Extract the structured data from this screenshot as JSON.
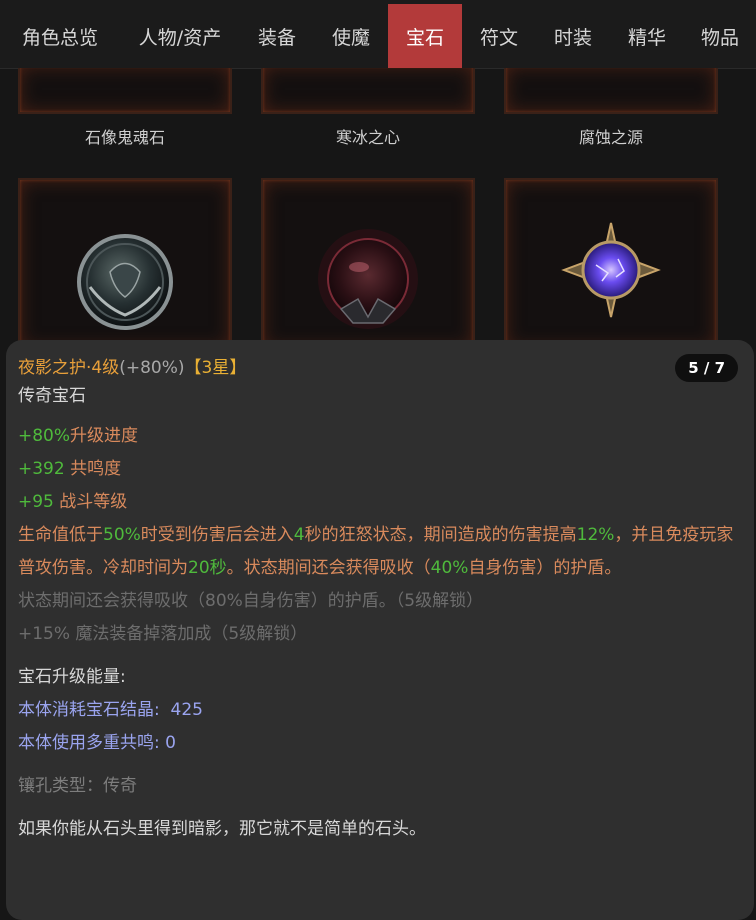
{
  "tabs": [
    {
      "label": "角色总览",
      "active": false
    },
    {
      "label": "人物/资产",
      "active": false
    },
    {
      "label": "装备",
      "active": false
    },
    {
      "label": "使魔",
      "active": false
    },
    {
      "label": "宝石",
      "active": true
    },
    {
      "label": "符文",
      "active": false
    },
    {
      "label": "时装",
      "active": false
    },
    {
      "label": "精华",
      "active": false
    },
    {
      "label": "物品",
      "active": false
    }
  ],
  "gems_row1": [
    "石像鬼魂石",
    "寒冰之心",
    "腐蚀之源"
  ],
  "tooltip": {
    "name": "夜影之护·4级",
    "bonus": "(+80%)",
    "stars": "【3星】",
    "counter": "5 / 7",
    "type": "传奇宝石",
    "stats": [
      {
        "value": "+80%",
        "label": "升级进度"
      },
      {
        "value": "+392",
        "label": " 共鸣度"
      },
      {
        "value": "+95",
        "label": " 战斗等级"
      }
    ],
    "desc": {
      "p1": "生命值低于",
      "v1": "50%",
      "p2": "时受到伤害后会进入",
      "v2": "4",
      "p3": "秒的狂怒状态，期间造成的伤害提高",
      "v3": "12%",
      "p4": "，并且免疫玩家普攻伤害。冷却时间为",
      "v4": "20秒",
      "p5": "。状态期间还会获得吸收（",
      "v5": "40%",
      "p6": "自身伤害）的护盾。"
    },
    "locked1": "状态期间还会获得吸收（80%自身伤害）的护盾。（5级解锁）",
    "locked2": "+15% 魔法装备掉落加成（5级解锁）",
    "energy_title": "宝石升级能量:",
    "energy1_label": "本体消耗宝石结晶:",
    "energy1_value": "425",
    "energy2_label": "本体使用多重共鸣:",
    "energy2_value": "0",
    "socket": "镶孔类型：传奇",
    "flavor": "如果你能从石头里得到暗影，那它就不是简单的石头。"
  },
  "colors": {
    "active_tab": "#b33a3a",
    "gem_name": "#e9a03a",
    "stat_value": "#4fba3c",
    "desc": "#d98a5c",
    "energy": "#9aa4ef"
  }
}
